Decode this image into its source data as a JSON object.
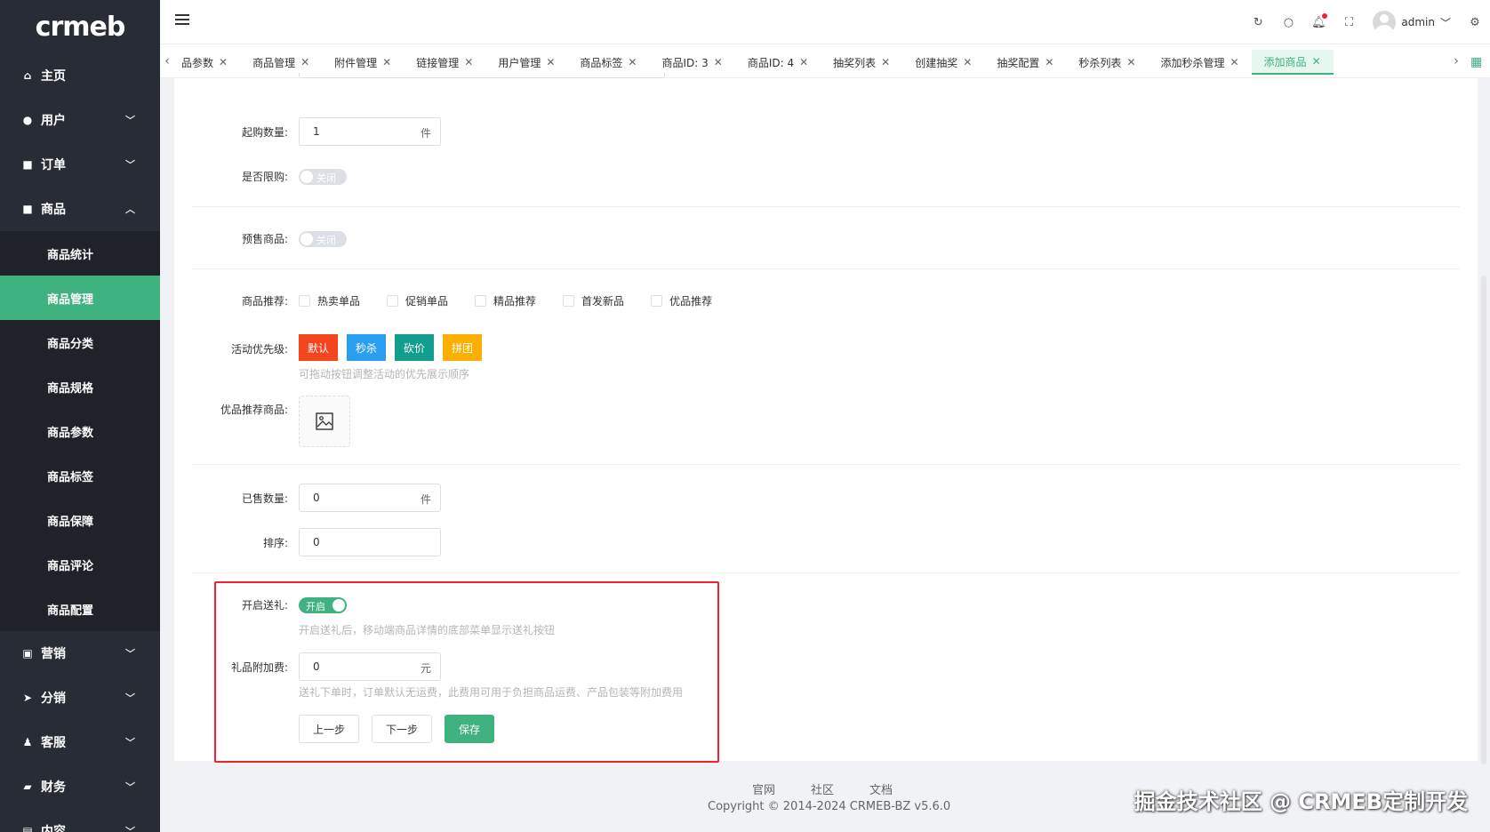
{
  "sidebar": {
    "logo": "crmeb",
    "menu": [
      {
        "label": "主页",
        "icon": "home-icon"
      },
      {
        "label": "用户",
        "icon": "user-icon"
      },
      {
        "label": "订单",
        "icon": "order-icon"
      },
      {
        "label": "商品",
        "icon": "product-icon"
      }
    ],
    "submenu": [
      {
        "label": "商品统计"
      },
      {
        "label": "商品管理",
        "active": true
      },
      {
        "label": "商品分类"
      },
      {
        "label": "商品规格"
      },
      {
        "label": "商品参数"
      },
      {
        "label": "商品标签"
      },
      {
        "label": "商品保障"
      },
      {
        "label": "商品评论"
      },
      {
        "label": "商品配置"
      }
    ],
    "menu_bottom": [
      {
        "label": "营销",
        "icon": "marketing-icon"
      },
      {
        "label": "分销",
        "icon": "distribution-icon"
      },
      {
        "label": "客服",
        "icon": "service-icon"
      },
      {
        "label": "财务",
        "icon": "finance-icon"
      },
      {
        "label": "内容",
        "icon": "content-icon"
      }
    ]
  },
  "header": {
    "username": "admin",
    "icons": [
      "refresh-icon",
      "search-icon",
      "bell-icon",
      "fullscreen-icon",
      "settings-icon"
    ]
  },
  "tabs": [
    {
      "label": "品参数"
    },
    {
      "label": "商品管理"
    },
    {
      "label": "附件管理"
    },
    {
      "label": "链接管理"
    },
    {
      "label": "用户管理"
    },
    {
      "label": "商品标签"
    },
    {
      "label": "商品ID: 3"
    },
    {
      "label": "商品ID: 4"
    },
    {
      "label": "抽奖列表"
    },
    {
      "label": "创建抽奖"
    },
    {
      "label": "抽奖配置"
    },
    {
      "label": "秒杀列表"
    },
    {
      "label": "添加秒杀管理"
    },
    {
      "label": "添加商品",
      "active": true
    }
  ],
  "form": {
    "min_purchase": {
      "label": "起购数量:",
      "value": "1",
      "suffix": "件"
    },
    "limit_purchase": {
      "label": "是否限购:",
      "switch_text": "关闭"
    },
    "presale": {
      "label": "预售商品:",
      "switch_text": "关闭"
    },
    "recommend": {
      "label": "商品推荐:",
      "options": [
        "热卖单品",
        "促销单品",
        "精品推荐",
        "首发新品",
        "优品推荐"
      ]
    },
    "priority": {
      "label": "活动优先级:",
      "buttons": [
        {
          "label": "默认",
          "color": "#f5451c"
        },
        {
          "label": "秒杀",
          "color": "#2a9ff0"
        },
        {
          "label": "砍价",
          "color": "#129e8e"
        },
        {
          "label": "拼团",
          "color": "#fbb000"
        }
      ],
      "hint": "可拖动按钮调整活动的优先展示顺序"
    },
    "featured": {
      "label": "优品推荐商品:"
    },
    "sold": {
      "label": "已售数量:",
      "value": "0",
      "suffix": "件"
    },
    "sort": {
      "label": "排序:",
      "value": "0"
    },
    "gift": {
      "label": "开启送礼:",
      "switch_text": "开启",
      "hint": "开启送礼后，移动端商品详情的底部菜单显示送礼按钮"
    },
    "gift_fee": {
      "label": "礼品附加费:",
      "value": "0",
      "suffix": "元",
      "hint": "送礼下单时，订单默认无运费，此费用可用于负担商品运费、产品包装等附加费用"
    },
    "buttons": {
      "prev": "上一步",
      "next": "下一步",
      "save": "保存"
    }
  },
  "footer": {
    "links": [
      "官网",
      "社区",
      "文档"
    ],
    "copyright": "Copyright © 2014-2024 CRMEB-BZ v5.6.0",
    "watermark": "掘金技术社区 @ CRMEB定制开发"
  },
  "colors": {
    "accent": "#3fb27f",
    "sidebar_bg": "#282c34",
    "highlight_border": "#f5222d"
  }
}
